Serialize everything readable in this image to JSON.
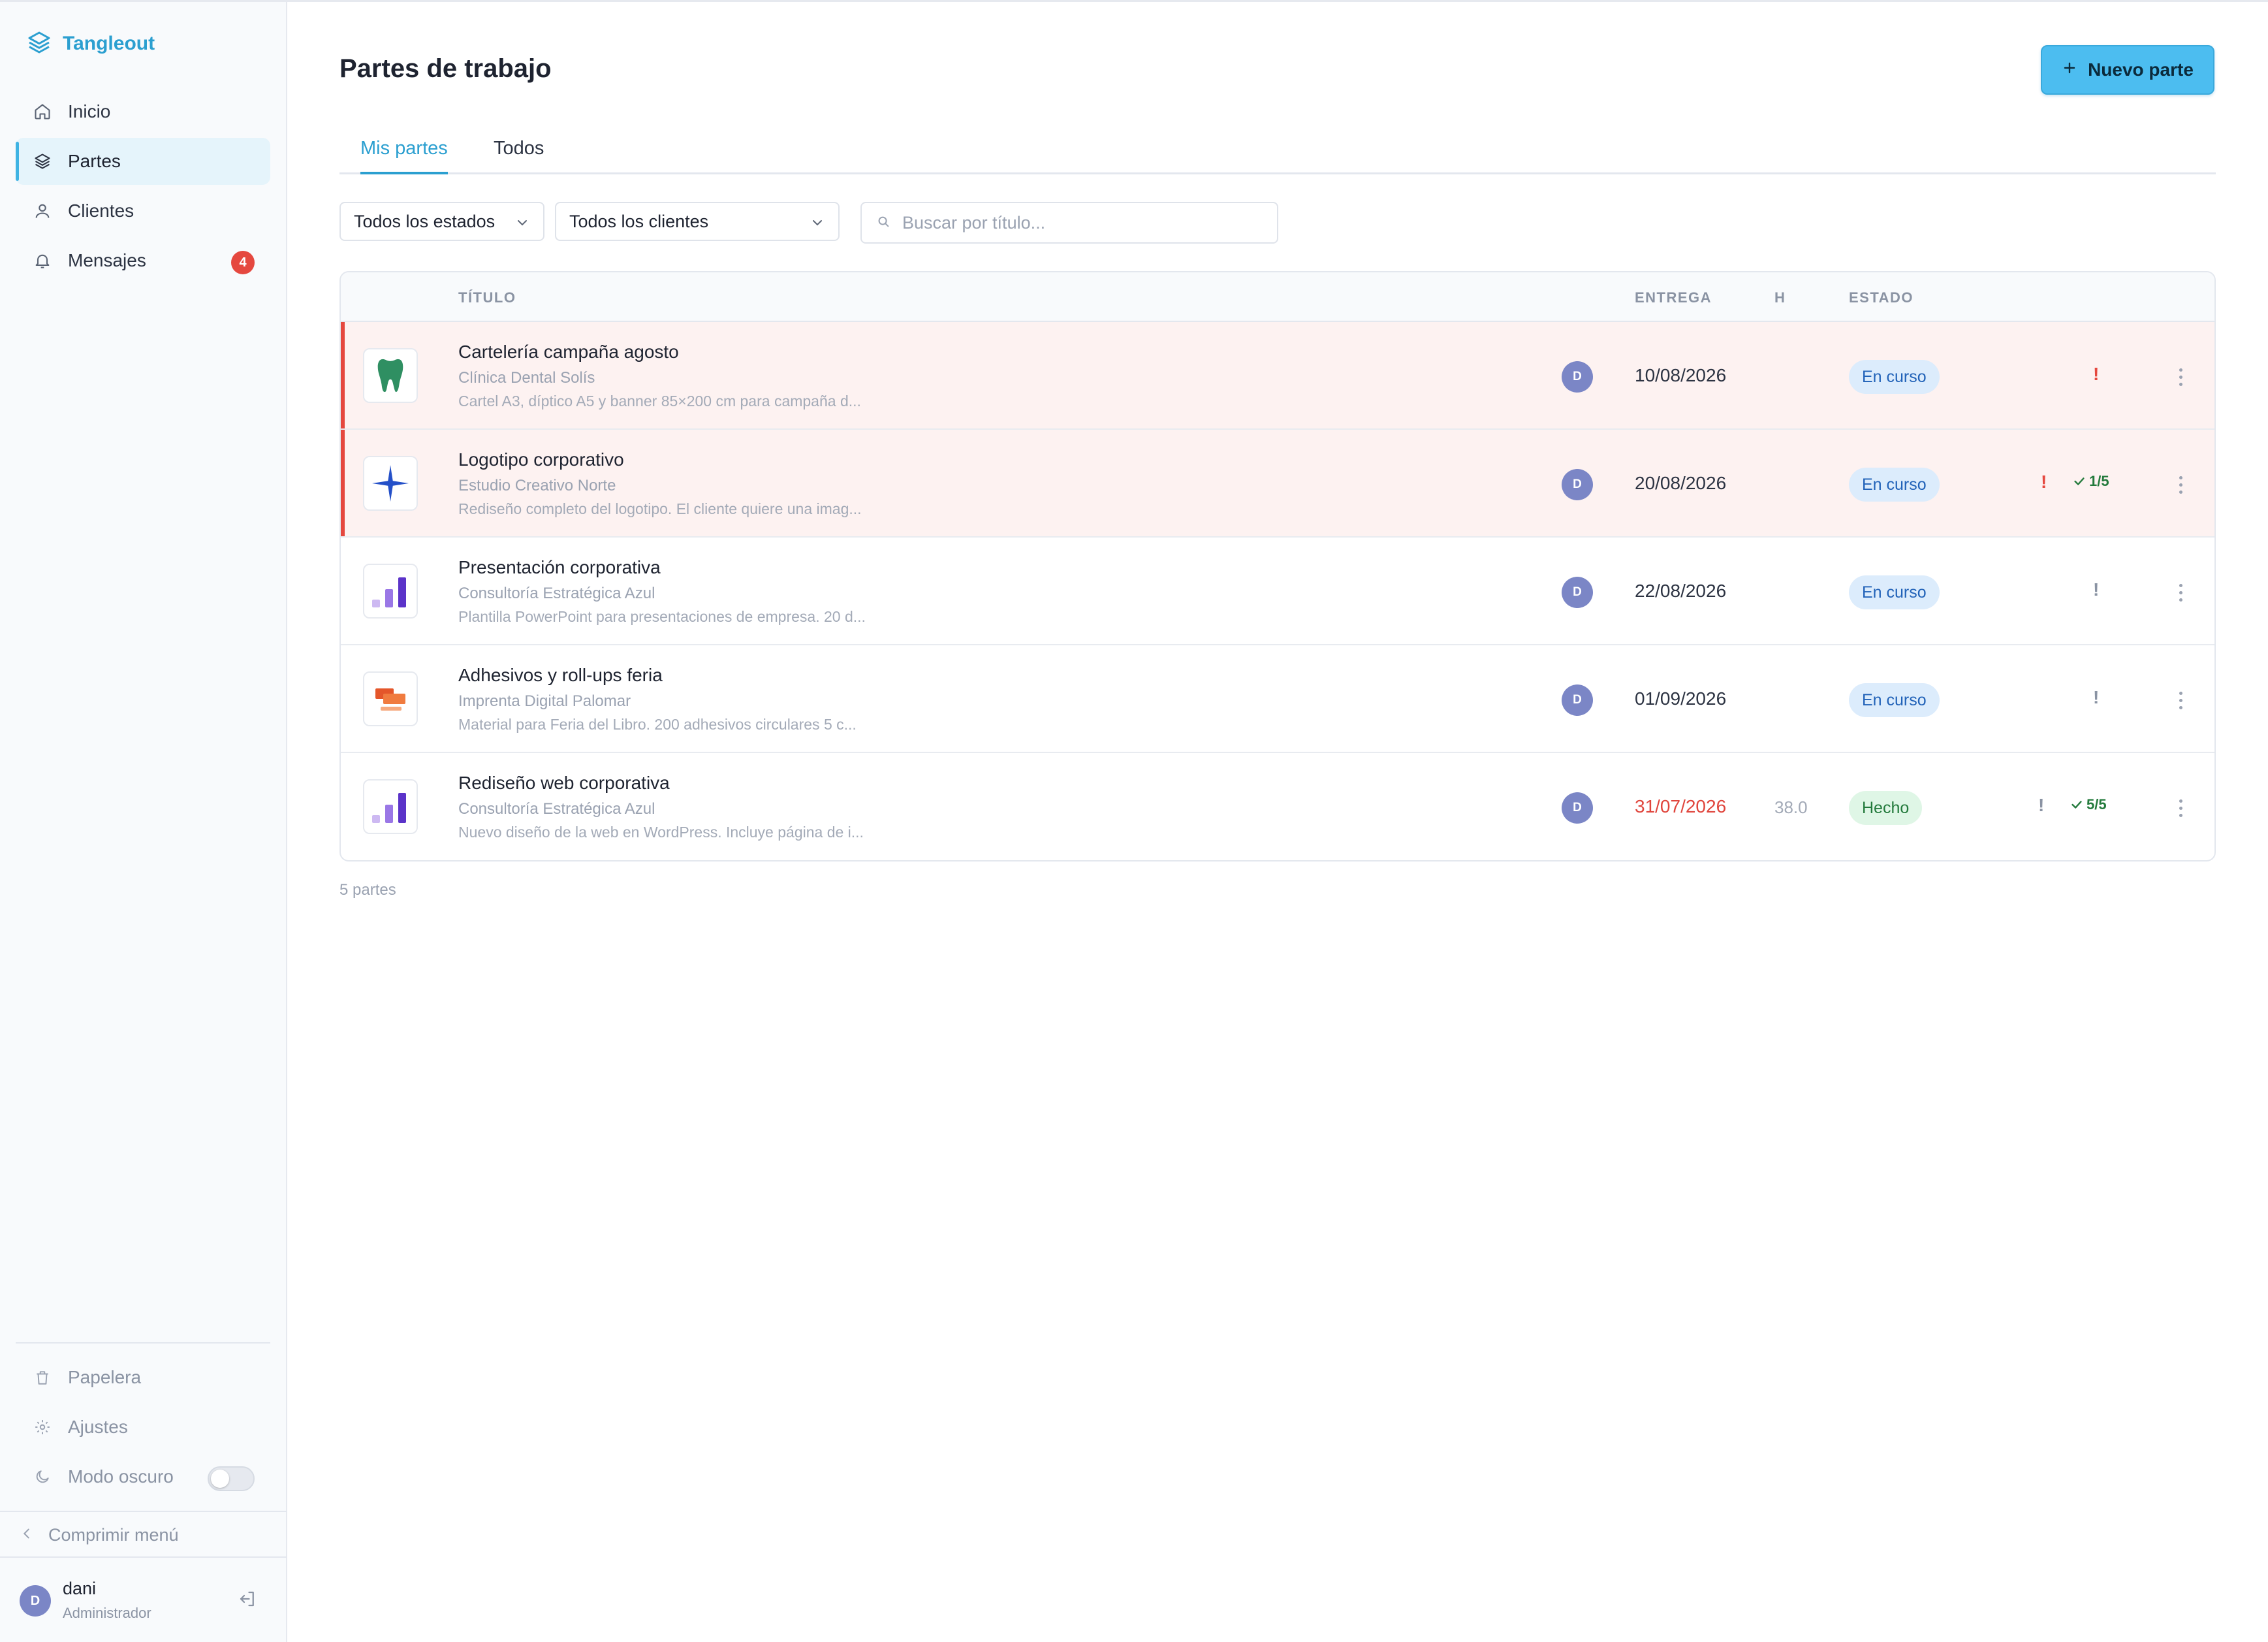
{
  "brand": {
    "name": "Tangleout"
  },
  "sidebar": {
    "items": [
      {
        "label": "Inicio",
        "icon": "home-icon"
      },
      {
        "label": "Partes",
        "icon": "layers-icon",
        "active": true
      },
      {
        "label": "Clientes",
        "icon": "user-icon"
      },
      {
        "label": "Mensajes",
        "icon": "bell-icon",
        "badge": "4"
      }
    ],
    "bottom": [
      {
        "label": "Papelera",
        "icon": "trash-icon"
      },
      {
        "label": "Ajustes",
        "icon": "gear-icon"
      },
      {
        "label": "Modo oscuro",
        "icon": "moon-icon",
        "toggle": false
      }
    ],
    "collapse_label": "Comprimir menú",
    "user": {
      "initial": "D",
      "name": "dani",
      "role": "Administrador"
    }
  },
  "header": {
    "title": "Partes de trabajo",
    "new_button": "Nuevo parte"
  },
  "tabs": [
    {
      "label": "Mis partes",
      "active": true
    },
    {
      "label": "Todos",
      "active": false
    }
  ],
  "filters": {
    "status": "Todos los estados",
    "client": "Todos los clientes",
    "search_placeholder": "Buscar por título..."
  },
  "table": {
    "columns": {
      "title": "TÍTULO",
      "due": "ENTREGA",
      "hours": "H",
      "status": "ESTADO"
    },
    "rows": [
      {
        "title": "Cartelería campaña agosto",
        "client": "Clínica Dental Solís",
        "desc": "Cartel A3, díptico A5 y banner 85×200 cm para campaña d...",
        "avatar": "D",
        "due": "10/08/2026",
        "hours": "",
        "status": "En curso",
        "thumb": "tooth-icon",
        "flag": "!",
        "checks": ""
      },
      {
        "title": "Logotipo corporativo",
        "client": "Estudio Creativo Norte",
        "desc": "Rediseño completo del logotipo. El cliente quiere una imag...",
        "avatar": "D",
        "due": "20/08/2026",
        "hours": "",
        "status": "En curso",
        "thumb": "star-icon",
        "flag": "!",
        "checks": "1/5"
      },
      {
        "title": "Presentación corporativa",
        "client": "Consultoría Estratégica Azul",
        "desc": "Plantilla PowerPoint para presentaciones de empresa. 20 d...",
        "avatar": "D",
        "due": "22/08/2026",
        "hours": "",
        "status": "En curso",
        "thumb": "bars-icon",
        "flag": "!",
        "checks": ""
      },
      {
        "title": "Adhesivos y roll-ups feria",
        "client": "Imprenta Digital Palomar",
        "desc": "Material para Feria del Libro. 200 adhesivos circulares 5 c...",
        "avatar": "D",
        "due": "01/09/2026",
        "hours": "",
        "status": "En curso",
        "thumb": "print-icon",
        "flag": "!",
        "checks": ""
      },
      {
        "title": "Rediseño web corporativa",
        "client": "Consultoría Estratégica Azul",
        "desc": "Nuevo diseño de la web en WordPress. Incluye página de i...",
        "avatar": "D",
        "due": "31/07/2026",
        "hours": "38.0",
        "status": "Hecho",
        "thumb": "bars-icon",
        "flag": "!",
        "checks": "5/5"
      }
    ]
  },
  "footer": {
    "count": "5 partes"
  },
  "colors": {
    "accent": "#2b9fd0",
    "button": "#4cbdf0",
    "danger": "#e5483f",
    "success": "#237a3c"
  }
}
